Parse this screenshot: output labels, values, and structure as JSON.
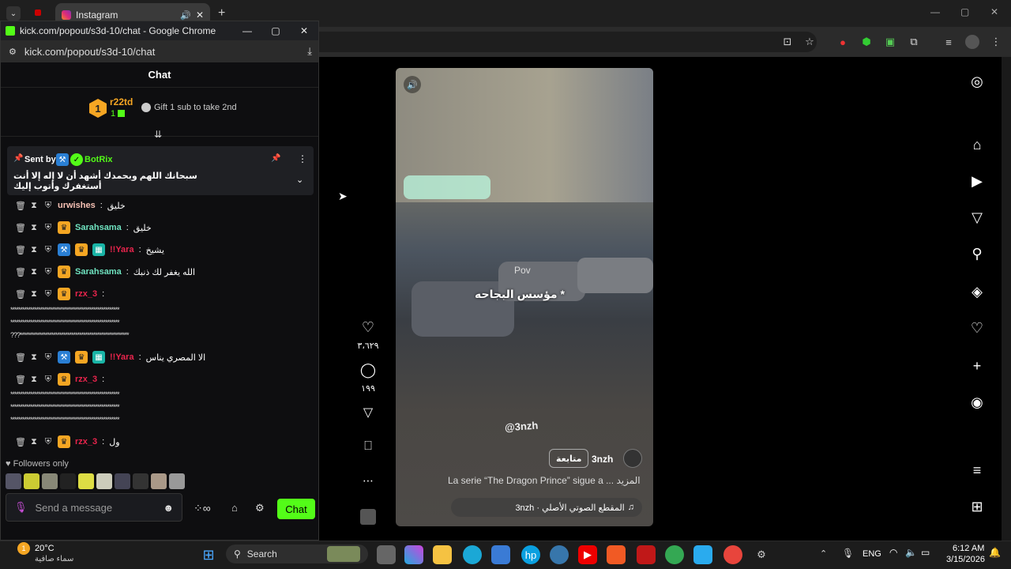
{
  "browser": {
    "tab_title": "Instagram",
    "popout_title": "kick.com/popout/s3d-10/chat - Google Chrome",
    "popout_url": "kick.com/popout/s3d-10/chat"
  },
  "chat": {
    "header": "Chat",
    "leader": {
      "rank": "1",
      "name": "r22td",
      "count": "1",
      "gift_text": "Gift 1 sub to take 2nd"
    },
    "pinned": {
      "sent_by": "Sent by",
      "sender": "BotRix",
      "text": "سبحانك اللهم وبحمدك أشهد أن لا إله إلا أنت أستغفرك وأتوب إليك"
    },
    "messages": [
      {
        "user": "urwishes",
        "text": "خليق"
      },
      {
        "user": "Sarahsama",
        "text": "خليق"
      },
      {
        "user": "!!Yara",
        "text": "يشيخ"
      },
      {
        "user": "Sarahsama",
        "text": "الله يغفر لك ذنبك"
      },
      {
        "user": "rzx_3",
        "text": ""
      },
      {
        "user": "!!Yara",
        "text": "الا المصري يناس"
      },
      {
        "user": "rzx_3",
        "text": ""
      },
      {
        "user": "rzx_3",
        "text": "ول"
      }
    ],
    "stars_lines": [
      "*******************************************************",
      "*******************************************************",
      "???*******************************************************",
      "*******************************************************",
      "*******************************************************",
      "*******************************************************"
    ],
    "followers_only": "Followers only",
    "message_placeholder": "Send a message",
    "chat_button": "Chat"
  },
  "reel": {
    "sign_text": "Pov",
    "overlay_text": "مؤسس البجاحه *",
    "watermark": "@3nzh",
    "username": "3nzh",
    "follow_label": "متابعة",
    "caption": "La serie “The Dragon Prince” sigue a ... المزيد",
    "audio": "3nzh · المقطع الصوتي الأصلي",
    "likes": "٣،٦٢٩",
    "comments": "١٩٩"
  },
  "taskbar": {
    "weather_temp": "20°C",
    "weather_desc": "سماء صافية",
    "search": "Search",
    "lang": "ENG",
    "time": "6:12 AM",
    "date": "3/15/2026"
  }
}
